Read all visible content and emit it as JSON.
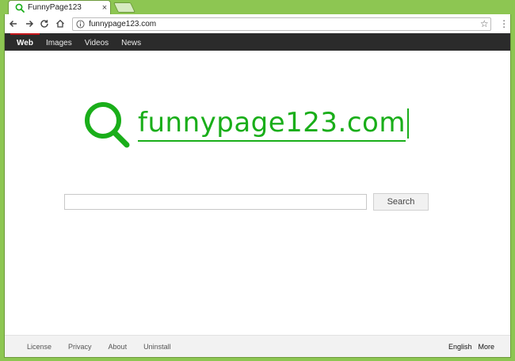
{
  "browser": {
    "tab_title": "FunnyPage123",
    "tab_close": "×",
    "url": "funnypage123.com",
    "bookmark_star": "☆",
    "menu": "⋮"
  },
  "topnav": {
    "items": [
      {
        "label": "Web",
        "active": true
      },
      {
        "label": "Images"
      },
      {
        "label": "Videos"
      },
      {
        "label": "News"
      }
    ]
  },
  "logo": {
    "text": "funnypage123.com",
    "color": "#1aae1a"
  },
  "search": {
    "input_value": "",
    "button_label": "Search"
  },
  "footer": {
    "links": [
      "License",
      "Privacy",
      "About",
      "Uninstall"
    ],
    "language": "English",
    "more": "More"
  },
  "colors": {
    "frame": "#8dc652",
    "nav_bg": "#2b2b2b",
    "active_tab_accent": "#c4161c"
  }
}
